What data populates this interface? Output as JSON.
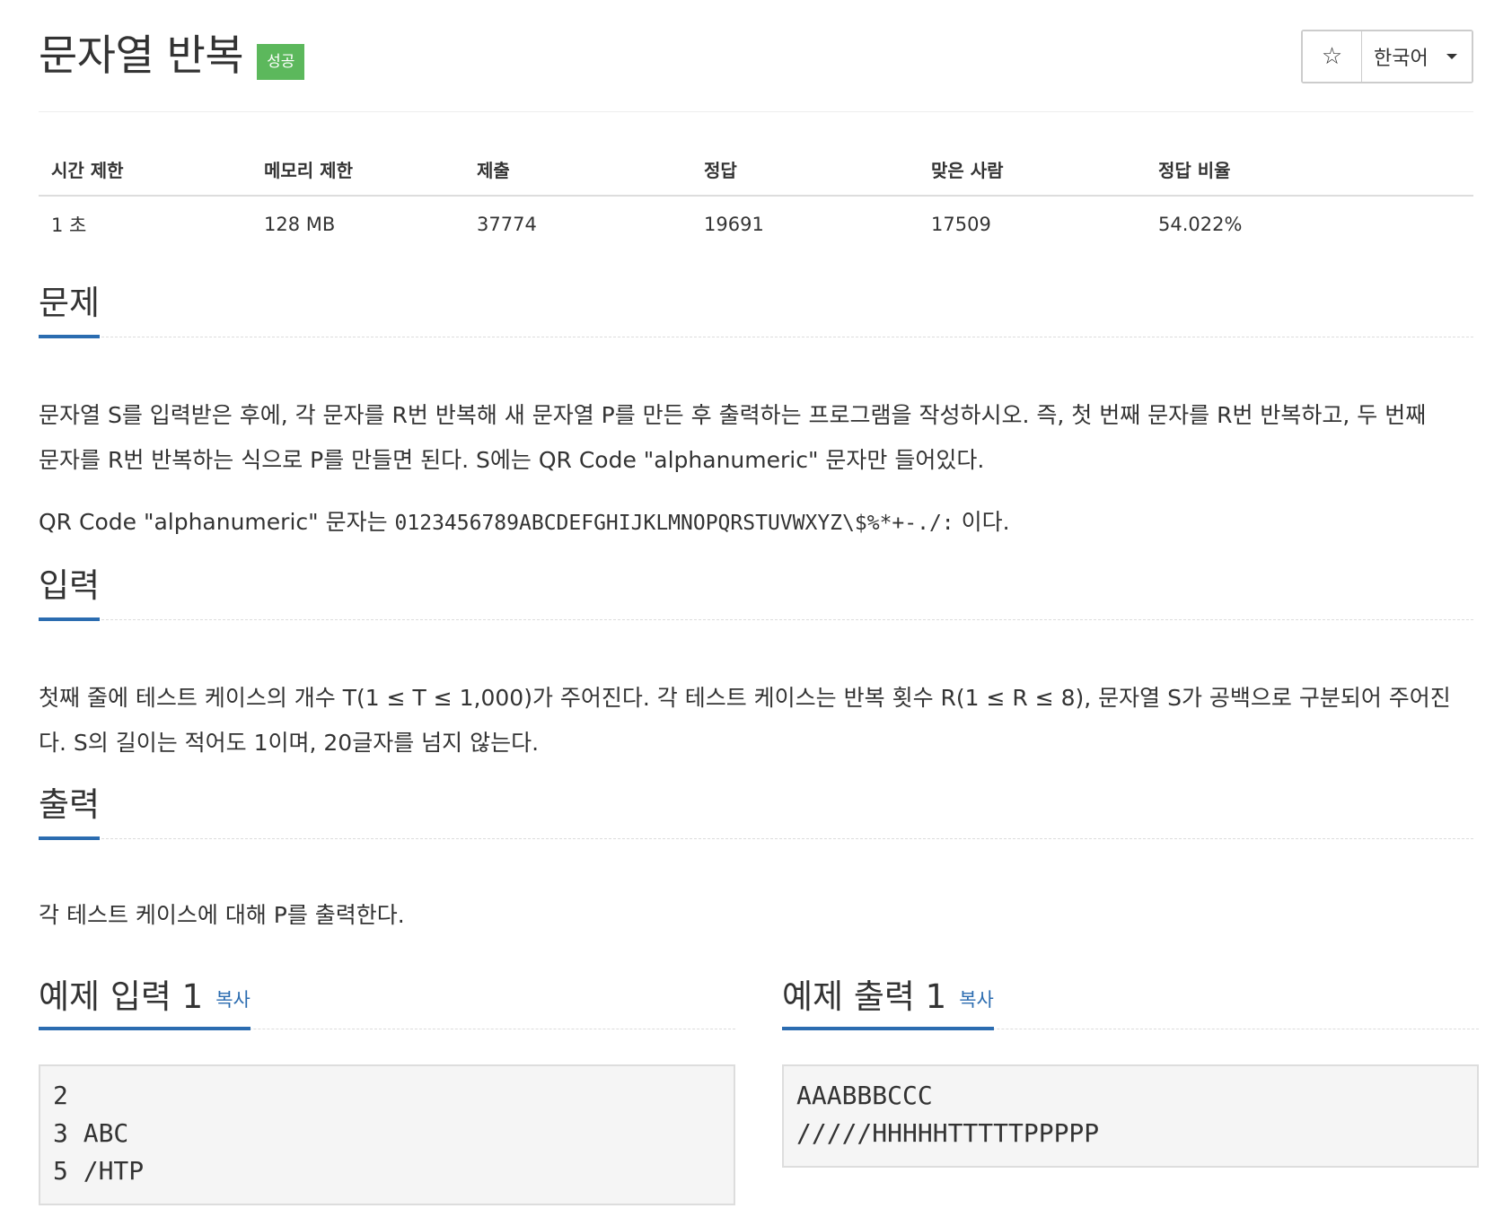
{
  "header": {
    "title": "문자열 반복",
    "badge": "성공",
    "star_label": "☆",
    "language": "한국어"
  },
  "info": {
    "columns": [
      "시간 제한",
      "메모리 제한",
      "제출",
      "정답",
      "맞은 사람",
      "정답 비율"
    ],
    "values": [
      "1 초",
      "128 MB",
      "37774",
      "19691",
      "17509",
      "54.022%"
    ]
  },
  "problem": {
    "heading": "문제",
    "line1": "문자열 S를 입력받은 후에, 각 문자를 R번 반복해 새 문자열 P를 만든 후 출력하는 프로그램을 작성하시오. 즉, 첫 번째 문자를 R번 반복하고, 두 번째",
    "line2": "문자를 R번 반복하는 식으로 P를 만들면 된다. S에는 QR Code \"alphanumeric\" 문자만 들어있다.",
    "qr_prefix": "QR Code \"alphanumeric\" 문자는 ",
    "qr_chars": "0123456789ABCDEFGHIJKLMNOPQRSTUVWXYZ\\$%*+-./:",
    "qr_suffix": " 이다."
  },
  "input": {
    "heading": "입력",
    "line1": "첫째 줄에 테스트 케이스의 개수 T(1 ≤ T ≤ 1,000)가 주어진다. 각 테스트 케이스는 반복 횟수 R(1 ≤ R ≤ 8), 문자열 S가 공백으로 구분되어 주어진",
    "line2": "다. S의 길이는 적어도 1이며, 20글자를 넘지 않는다."
  },
  "output": {
    "heading": "출력",
    "text": "각 테스트 케이스에 대해 P를 출력한다."
  },
  "sample_input": {
    "heading": "예제 입력 1",
    "copy": "복사",
    "content": "2\n3 ABC\n5 /HTP"
  },
  "sample_output": {
    "heading": "예제 출력 1",
    "copy": "복사",
    "content": "AAABBBCCC\n/////HHHHHTTTTTPPPPP"
  }
}
